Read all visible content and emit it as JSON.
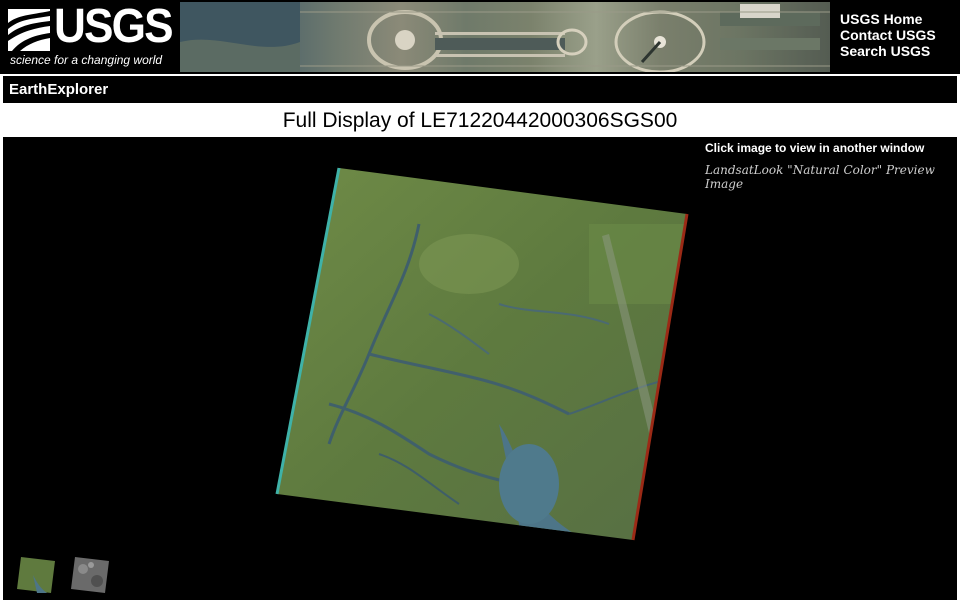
{
  "header": {
    "logo_word": "USGS",
    "logo_tagline": "science for a changing world",
    "links": [
      "USGS Home",
      "Contact USGS",
      "Search USGS"
    ]
  },
  "app": {
    "name": "EarthExplorer"
  },
  "page": {
    "title": "Full Display of LE71220442000306SGS00"
  },
  "viewer": {
    "click_note": "Click image to view in another window",
    "caption": "LandsatLook \"Natural Color\" Preview Image",
    "thumbnails": [
      "natural-color-thumbnail",
      "grayscale-thumbnail"
    ]
  },
  "colors": {
    "background": "#000000",
    "title_bg": "#ffffff",
    "scene_land": "#5f7a3e",
    "scene_water": "#4a6f82"
  }
}
